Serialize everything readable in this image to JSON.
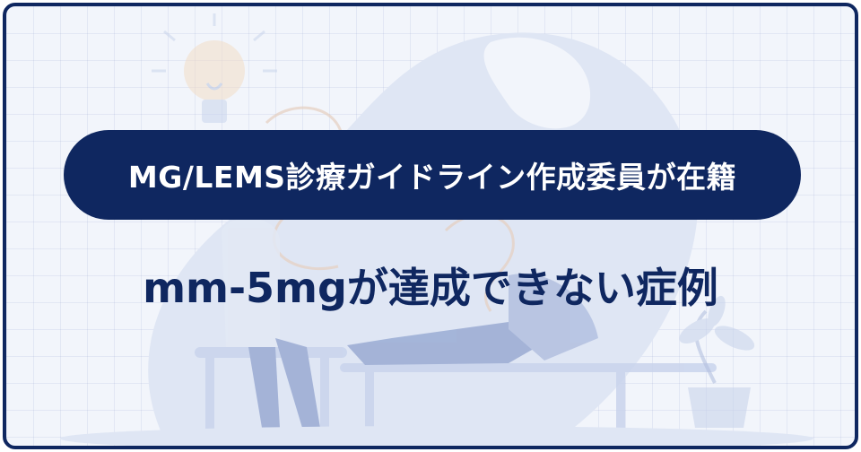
{
  "badge": {
    "text": "MG/LEMS診療ガイドライン作成委員が在籍"
  },
  "headline": {
    "text": "mm-5mgが達成できない症例"
  },
  "colors": {
    "navy": "#0f2760",
    "background": "#f2f5fb",
    "illustration": "#c9d4ec"
  },
  "icons": [
    "lightbulb-icon",
    "plant-icon"
  ]
}
